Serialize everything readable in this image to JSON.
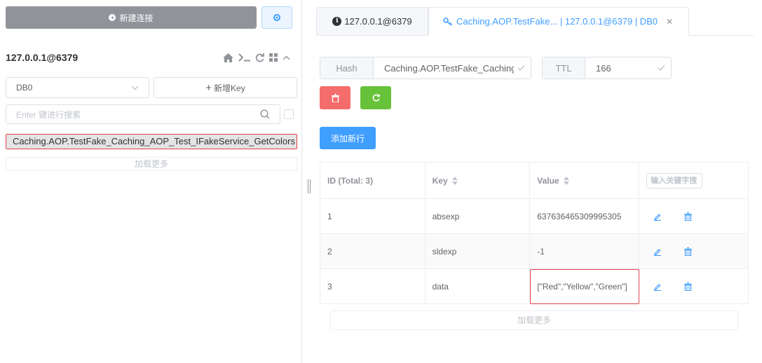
{
  "sidebar": {
    "new_connection_label": "新建连接",
    "connection_title": "127.0.0.1@6379",
    "db_select_value": "DB0",
    "new_key_label": "新增Key",
    "search_placeholder": "Enter 键进行搜索",
    "keys": [
      "Caching.AOP.TestFake_Caching_AOP_Test_IFakeService_GetColors"
    ],
    "load_more_label": "加载更多"
  },
  "tabs": [
    {
      "label": "127.0.0.1@6379",
      "icon": "info-icon",
      "active": false
    },
    {
      "label": "Caching.AOP.TestFake... | 127.0.0.1@6379 | DB0",
      "icon": "key-icon",
      "active": true
    }
  ],
  "detail": {
    "type_label": "Hash",
    "key_name": "Caching.AOP.TestFake_Caching_",
    "ttl_label": "TTL",
    "ttl_value": "166",
    "add_row_label": "添加新行",
    "load_more_label": "加载更多",
    "table": {
      "columns": [
        "ID (Total: 3)",
        "Key",
        "Value"
      ],
      "keyword_placeholder": "输入关键字搜",
      "rows": [
        {
          "id": "1",
          "key": "absexp",
          "value": "637636465309995305"
        },
        {
          "id": "2",
          "key": "sldexp",
          "value": "-1"
        },
        {
          "id": "3",
          "key": "data",
          "value": "[\"Red\",\"Yellow\",\"Green\"]"
        }
      ]
    }
  },
  "colors": {
    "primary": "#409eff",
    "danger": "#f56c6c",
    "success": "#67c23a",
    "neutral_button": "#909399",
    "highlight_border": "#e0424b"
  }
}
